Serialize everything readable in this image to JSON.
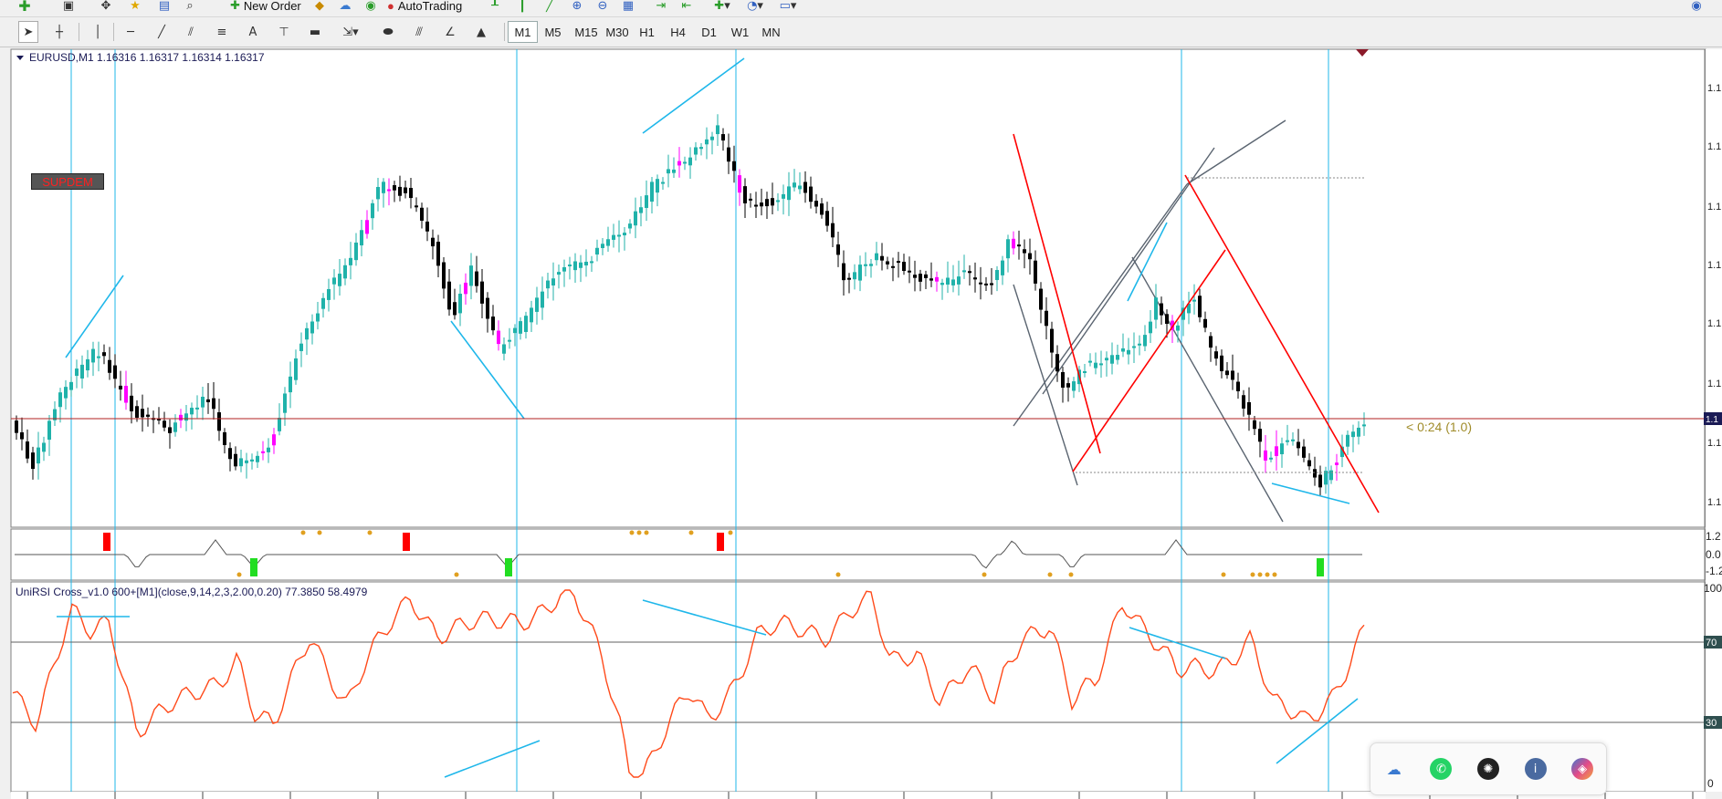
{
  "toolbar": {
    "new_order_label": "New Order",
    "autotrading_label": "AutoTrading",
    "timeframes": [
      "M1",
      "M5",
      "M15",
      "M30",
      "H1",
      "H4",
      "D1",
      "W1",
      "MN"
    ],
    "active_timeframe": "M1"
  },
  "chart": {
    "symbol_header": "EURUSD,M1  1.16316 1.16317 1.16314 1.16317",
    "badge_text": "SUPDEM",
    "countdown_text": "< 0:24 (1.0)",
    "price_axis_labels": [
      "1.1",
      "1.1",
      "1.1",
      "1.1",
      "1.1",
      "1.1",
      "1.1",
      "1.1"
    ],
    "current_price_label": "1.1",
    "colors": {
      "bull_candle": "#20b2aa",
      "bear_candle": "#000000",
      "doji_candle": "#ff00ff",
      "price_line": "#b22222",
      "cyan_lines": "#1fb7ea",
      "red_channel": "#ff0000",
      "grey_channel": "#5a6470"
    }
  },
  "signal_panel": {
    "axis_labels": [
      "1.2",
      "0.0",
      "-1.2"
    ]
  },
  "rsi_panel": {
    "header": "UniRSI Cross_v1.0 600+[M1](close,9,14,2,3,2.00,0.20) 77.3850 58.4979",
    "axis_labels": [
      "100",
      "70",
      "30",
      "0"
    ],
    "line_color": "#ff4a1a",
    "level_high": 70,
    "level_low": 30
  },
  "tray": {
    "icons": [
      "cloud-icon",
      "whatsapp-icon",
      "chatgpt-icon",
      "cloud-info-icon",
      "copilot-icon"
    ]
  }
}
